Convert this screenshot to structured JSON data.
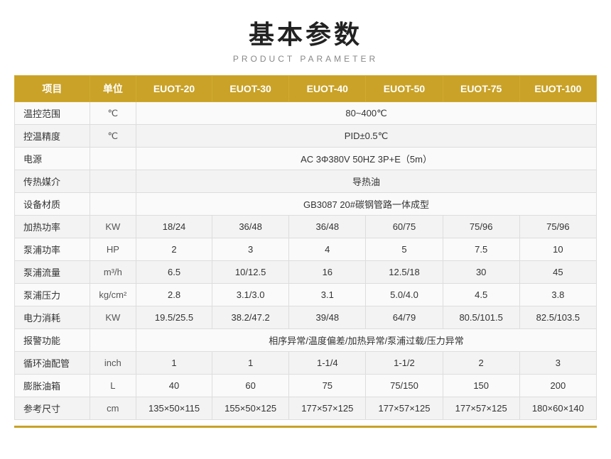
{
  "title": {
    "cn": "基本参数",
    "en": "PRODUCT PARAMETER"
  },
  "table": {
    "headers": [
      "项目",
      "单位",
      "EUOT-20",
      "EUOT-30",
      "EUOT-40",
      "EUOT-50",
      "EUOT-75",
      "EUOT-100"
    ],
    "rows": [
      {
        "label": "温控范围",
        "unit": "℃",
        "span": true,
        "value": "80~400℃"
      },
      {
        "label": "控温精度",
        "unit": "℃",
        "span": true,
        "value": "PID±0.5℃"
      },
      {
        "label": "电源",
        "unit": "",
        "span": true,
        "value": "AC 3Φ380V 50HZ 3P+E（5m）"
      },
      {
        "label": "传热媒介",
        "unit": "",
        "span": true,
        "value": "导热油"
      },
      {
        "label": "设备材质",
        "unit": "",
        "span": true,
        "value": "GB3087   20#碳钢管路一体成型"
      },
      {
        "label": "加热功率",
        "unit": "KW",
        "span": false,
        "values": [
          "18/24",
          "36/48",
          "36/48",
          "60/75",
          "75/96",
          "75/96"
        ]
      },
      {
        "label": "泵浦功率",
        "unit": "HP",
        "span": false,
        "values": [
          "2",
          "3",
          "4",
          "5",
          "7.5",
          "10"
        ]
      },
      {
        "label": "泵浦流量",
        "unit": "m³/h",
        "span": false,
        "values": [
          "6.5",
          "10/12.5",
          "16",
          "12.5/18",
          "30",
          "45"
        ]
      },
      {
        "label": "泵浦压力",
        "unit": "kg/cm²",
        "span": false,
        "values": [
          "2.8",
          "3.1/3.0",
          "3.1",
          "5.0/4.0",
          "4.5",
          "3.8"
        ]
      },
      {
        "label": "电力消耗",
        "unit": "KW",
        "span": false,
        "values": [
          "19.5/25.5",
          "38.2/47.2",
          "39/48",
          "64/79",
          "80.5/101.5",
          "82.5/103.5"
        ]
      },
      {
        "label": "报警功能",
        "unit": "",
        "span": true,
        "value": "相序异常/温度偏差/加热异常/泵浦过载/压力异常"
      },
      {
        "label": "循环油配管",
        "unit": "inch",
        "span": false,
        "values": [
          "1",
          "1",
          "1-1/4",
          "1-1/2",
          "2",
          "3"
        ]
      },
      {
        "label": "膨胀油箱",
        "unit": "L",
        "span": false,
        "values": [
          "40",
          "60",
          "75",
          "75/150",
          "150",
          "200"
        ]
      },
      {
        "label": "参考尺寸",
        "unit": "cm",
        "span": false,
        "values": [
          "135×50×115",
          "155×50×125",
          "177×57×125",
          "177×57×125",
          "177×57×125",
          "180×60×140"
        ]
      }
    ]
  }
}
